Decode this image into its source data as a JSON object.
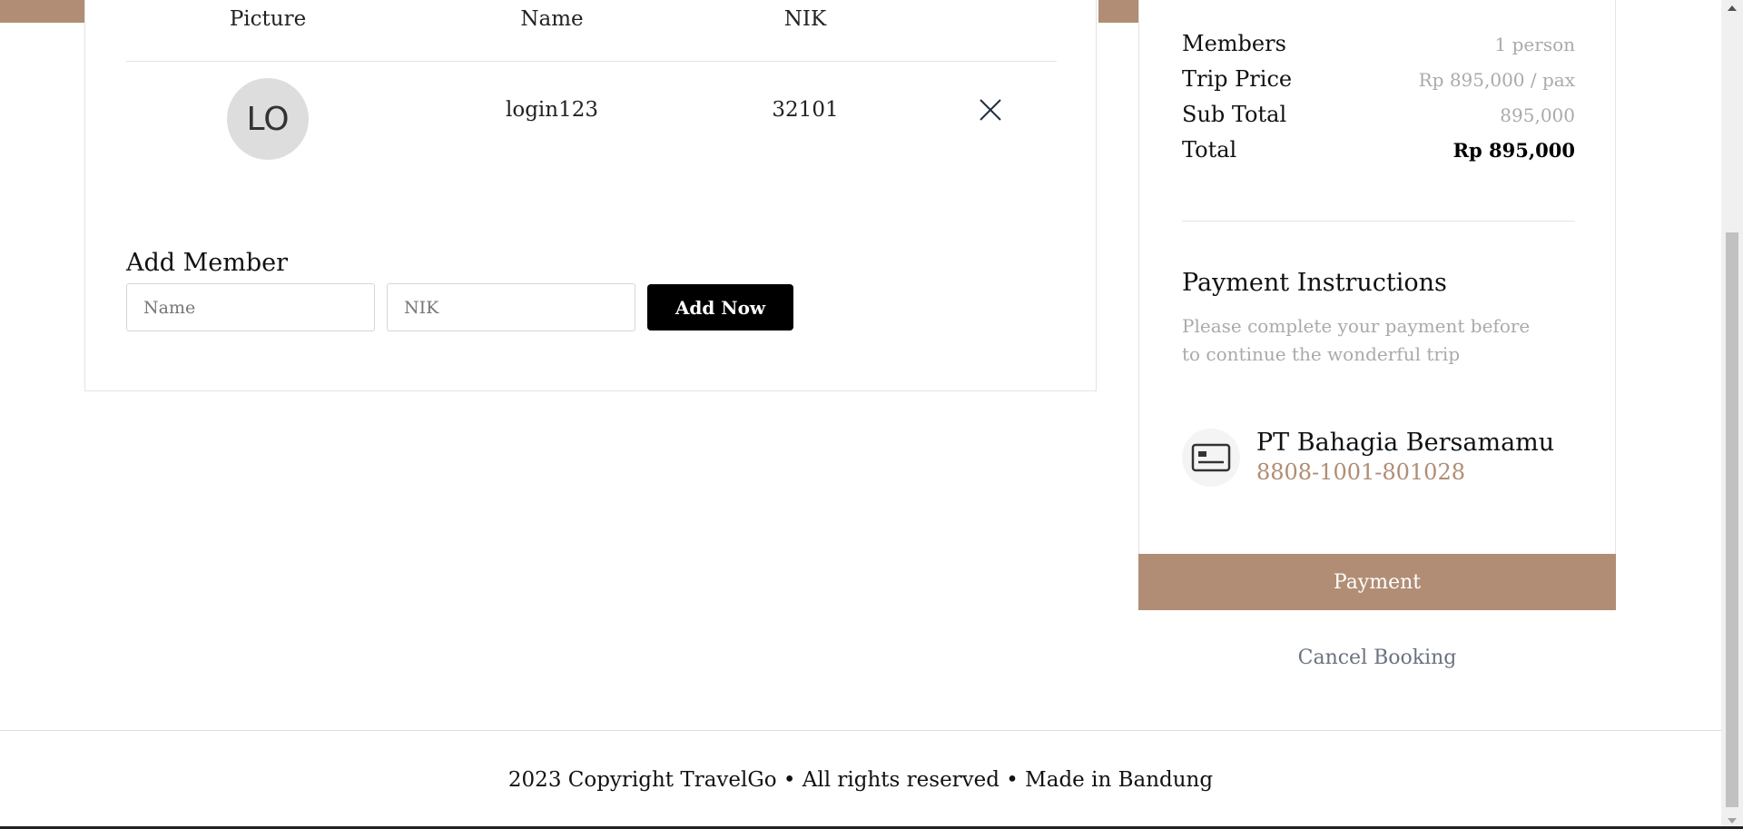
{
  "members_table": {
    "headers": [
      "Picture",
      "Name",
      "NIK"
    ],
    "rows": [
      {
        "avatar_initials": "LO",
        "name": "login123",
        "nik": "32101"
      }
    ]
  },
  "add_member": {
    "title": "Add Member",
    "name_placeholder": "Name",
    "nik_placeholder": "NIK",
    "button_label": "Add Now"
  },
  "summary": {
    "members_label": "Members",
    "members_value": "1 person",
    "trip_price_label": "Trip Price",
    "trip_price_value": "Rp 895,000 / pax",
    "subtotal_label": "Sub Total",
    "subtotal_value": "895,000",
    "total_label": "Total",
    "total_value": "Rp 895,000"
  },
  "payment": {
    "title": "Payment Instructions",
    "description": "Please complete your payment before to continue the wonderful trip",
    "bank_name": "PT Bahagia Bersamamu",
    "account_number": "8808-1001-801028",
    "pay_button": "Payment",
    "cancel_link": "Cancel Booking"
  },
  "footer": {
    "text": "2023 Copyright TravelGo • All rights reserved • Made in Bandung"
  },
  "icons": {
    "remove": "close-icon",
    "bank": "credit-card-icon"
  },
  "colors": {
    "accent": "#b08d74",
    "button_dark": "#000000",
    "muted_text": "#aaaaaa"
  }
}
